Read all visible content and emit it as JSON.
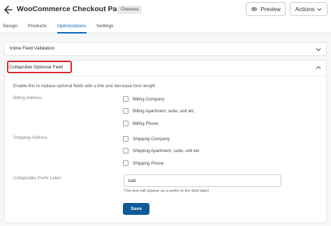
{
  "header": {
    "title": "WooCommerce Checkout Page",
    "badge": "Checkout",
    "preview_label": "Preview",
    "actions_label": "Actions"
  },
  "tabs": [
    {
      "label": "Design"
    },
    {
      "label": "Products"
    },
    {
      "label": "Optimizations",
      "active": true
    },
    {
      "label": "Settings"
    }
  ],
  "accordions": {
    "inline_validation": {
      "title": "Inline Field Validation"
    },
    "collapsible": {
      "title": "Collapsible Optional Field",
      "description": "Enable this to replace optional fields with a link and decrease form length",
      "billing_label": "Billing Address",
      "billing_fields": [
        "Billing Company",
        "Billing Apartment, suite, unit etc",
        "Billing Phone"
      ],
      "shipping_label": "Shipping Address",
      "shipping_fields": [
        "Shipping Company",
        "Shipping Apartment, suite, unit etc",
        "Shipping Phone"
      ],
      "prefix_label": "Collapsable Prefix Label",
      "prefix_value": "Add",
      "prefix_help": "This text will appear as a prefix to the field label",
      "save_label": "Save"
    }
  },
  "colors": {
    "accent": "#0a66c2",
    "save_button": "#0e5a96",
    "highlight": "#d8262a"
  }
}
